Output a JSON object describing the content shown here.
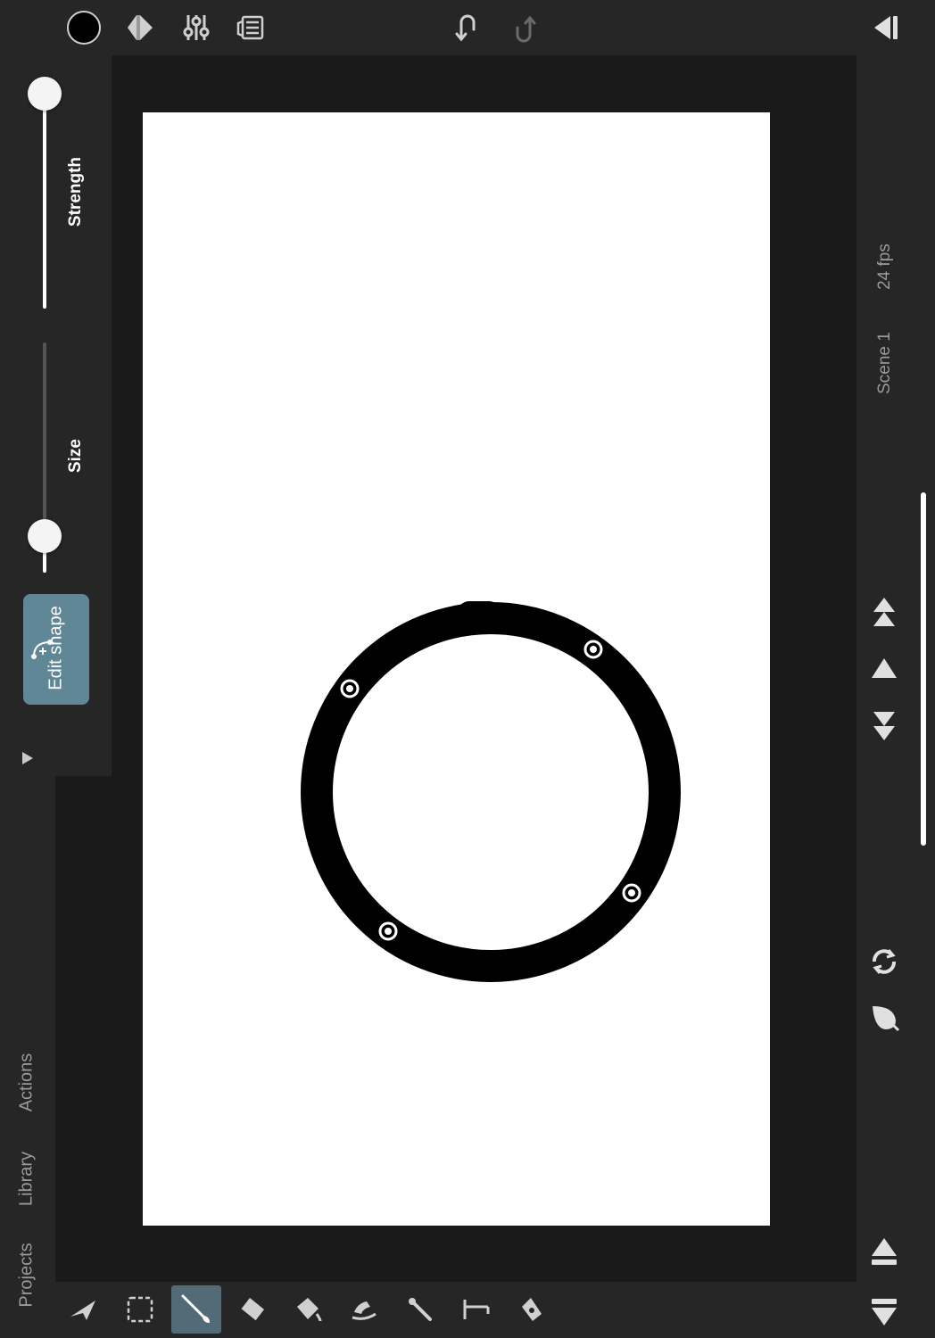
{
  "toolbar": {
    "color_swatch": "#000000",
    "icons": [
      "color-swatch-icon",
      "layers-diamond-icon",
      "adjustments-sliders-icon",
      "reference-icon",
      "undo-icon",
      "redo-icon",
      "collapse-panel-icon"
    ]
  },
  "brush_panel": {
    "strength_label": "Strength",
    "strength_level": 1.0,
    "size_label": "Size",
    "size_level": 0.15,
    "edit_shape_label": "Edit shape",
    "expand_icon": "play-arrow-icon"
  },
  "left_tabs": {
    "actions": "Actions",
    "library": "Library",
    "projects": "Projects"
  },
  "scene": {
    "fps": "24 fps",
    "name": "Scene 1"
  },
  "frame_controls": [
    "first-frame-icon",
    "previous-frame-icon",
    "last-frame-icon",
    "loop-icon",
    "onion-skin-icon",
    "move-up-icon",
    "move-down-icon"
  ],
  "tools": [
    {
      "name": "select-tool",
      "icon": "arrow-pointer-icon"
    },
    {
      "name": "marquee-tool",
      "icon": "dashed-rect-icon"
    },
    {
      "name": "brush-tool",
      "icon": "brush-icon",
      "active": true
    },
    {
      "name": "eraser-tool",
      "icon": "eraser-icon"
    },
    {
      "name": "fill-tool",
      "icon": "bucket-icon"
    },
    {
      "name": "smudge-tool",
      "icon": "smudge-icon"
    },
    {
      "name": "eyedropper-tool",
      "icon": "eyedropper-icon"
    },
    {
      "name": "ruler-tool",
      "icon": "ruler-icon"
    },
    {
      "name": "pen-tool",
      "icon": "pen-icon"
    }
  ],
  "colors": {
    "accent": "#5f8796",
    "active_tool": "#526b76",
    "panel": "#262626",
    "workspace": "#1a1a1a",
    "canvas": "#ffffff",
    "stroke": "#000000"
  }
}
